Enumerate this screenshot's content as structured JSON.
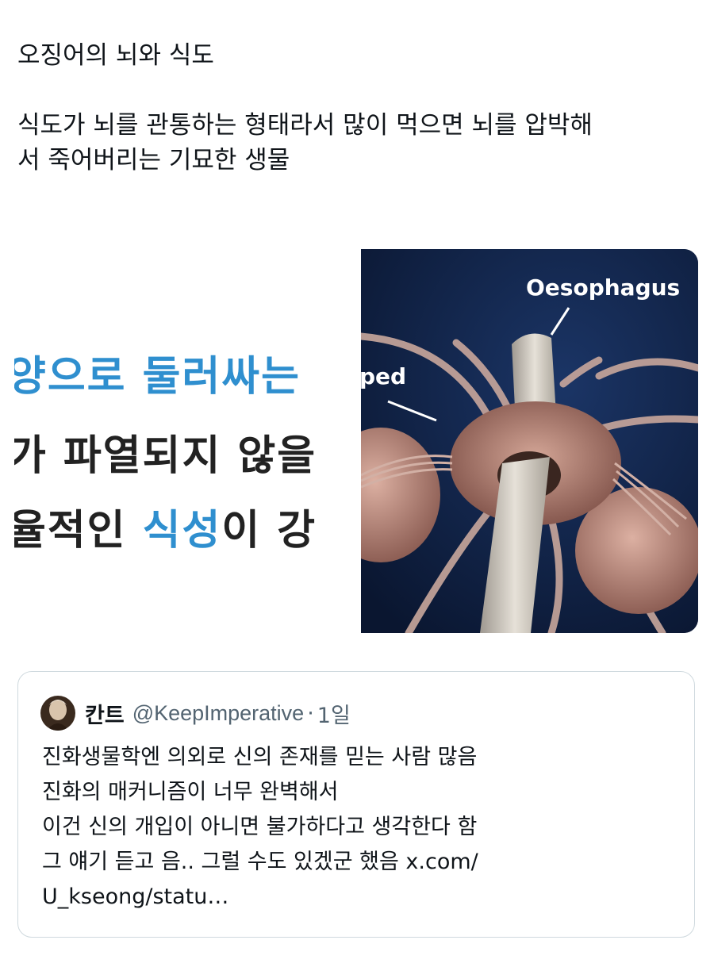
{
  "tweet": {
    "title_line": "오징어의 뇌와 식도",
    "body_line_1": "식도가 뇌를 관통하는 형태라서 많이 먹으면 뇌를 압박해",
    "body_line_2": "서 죽어버리는 기묘한 생물"
  },
  "media_left": {
    "line_1": "양으로 둘러싸는",
    "line_2_prefix": "가 파열되지 않을",
    "line_3_prefix": "율적인 ",
    "line_3_blue": "식성",
    "line_3_suffix": "이 강"
  },
  "media_right": {
    "label_oesophagus": "Oesophagus",
    "label_partial": "ped",
    "bg_color": "#0e1c3a",
    "tissue_color": "#b88a7c",
    "tube_color": "#d9d4cc"
  },
  "quote": {
    "author_name": "칸트",
    "author_handle": "@KeepImperative",
    "separator": "·",
    "time": "1일",
    "lines": [
      "진화생물학엔 의외로 신의 존재를 믿는 사람 많음",
      "진화의 매커니즘이 너무 완벽해서",
      "이건 신의 개입이 아니면 불가하다고 생각한다 함",
      "그 얘기 듣고 음.. 그럴 수도 있겠군 했음 x.com/",
      "U_kseong/statu…"
    ]
  }
}
